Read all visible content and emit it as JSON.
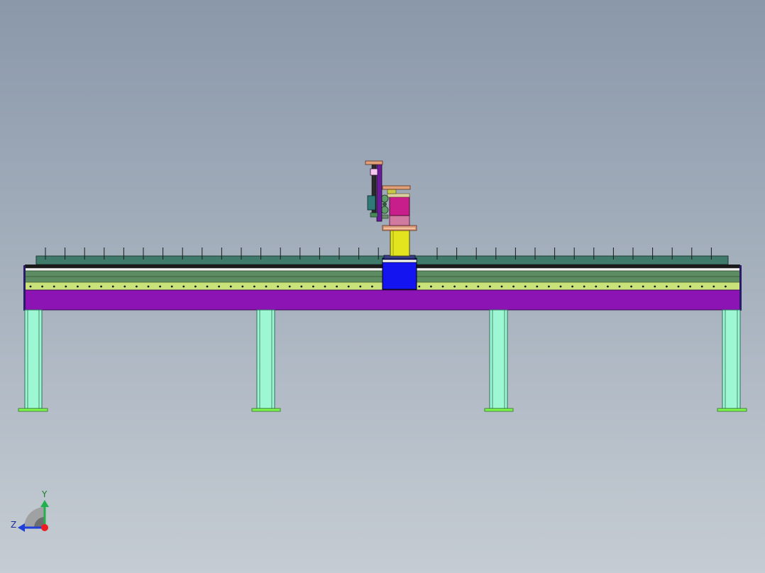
{
  "viewport": {
    "background_top": "#8a98aa",
    "background_bottom": "#c5ccd3"
  },
  "model": {
    "rail_color": "#3f7a6b",
    "frame_color": "#8c14b4",
    "beam_green": "#5e8c62",
    "beam_yellow": "#c9e27a",
    "leg_color": "#9ef7d3",
    "foot_color": "#7ef84a",
    "carriage_color": "#1414f0",
    "column_color": "#e3e31e",
    "motor_color": "#c81e8c",
    "arm_color": "#6a1b9a"
  },
  "triad": {
    "y_label": "Y",
    "z_label": "Z",
    "y_color": "#22b14c",
    "z_color": "#1f3fd8",
    "x_color": "#ed1c24"
  }
}
